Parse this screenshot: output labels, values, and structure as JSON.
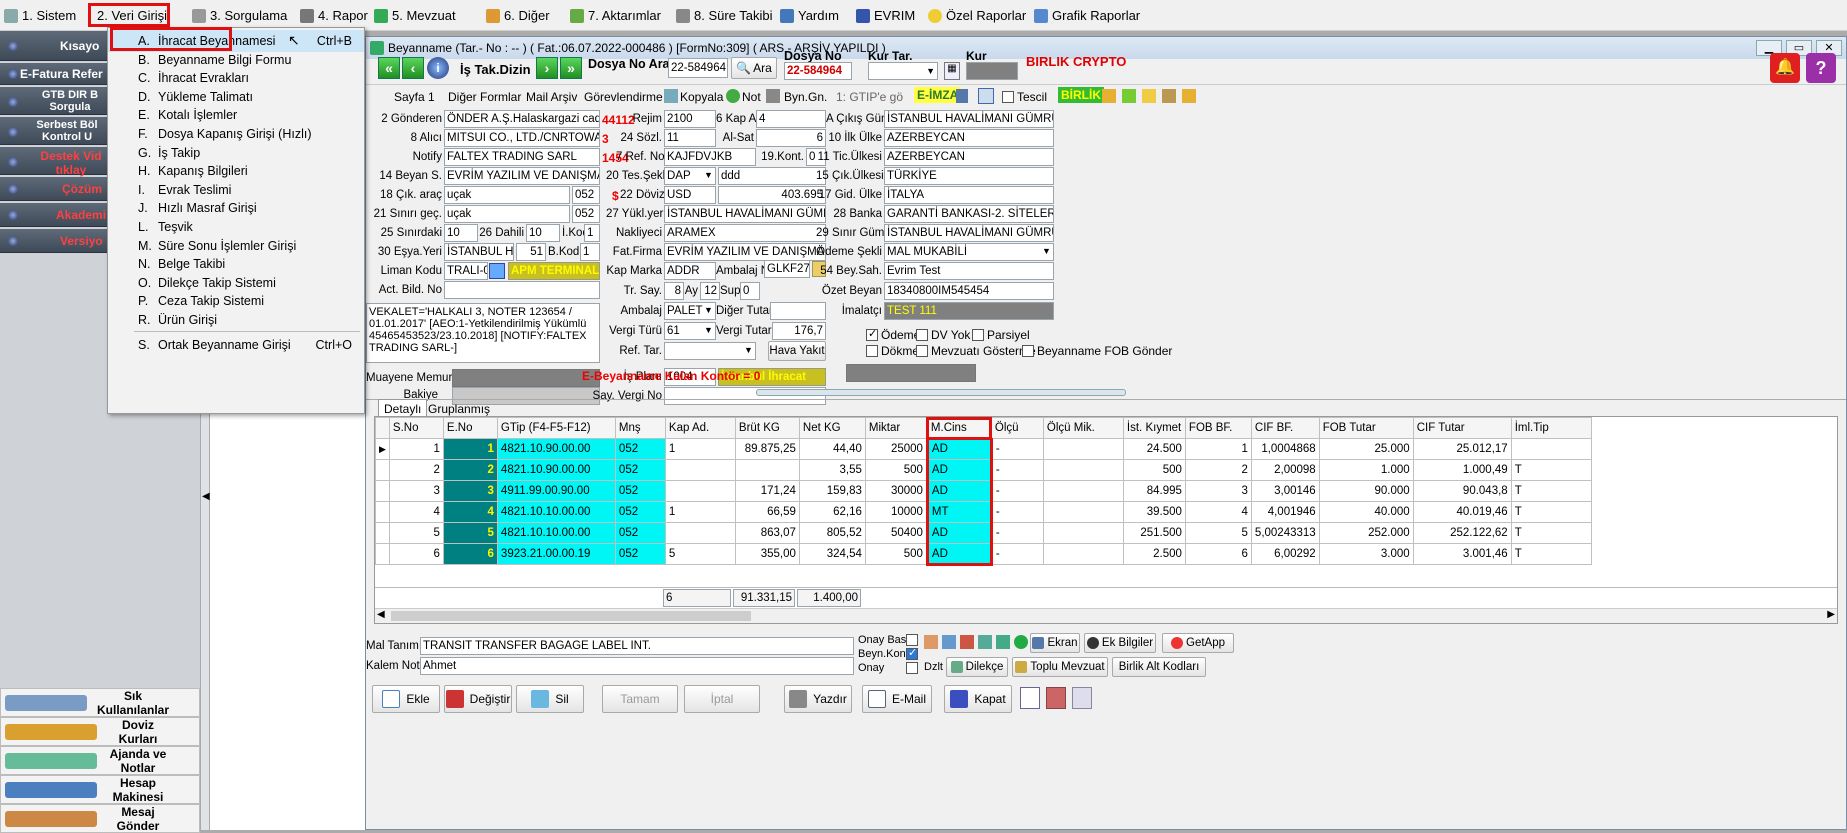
{
  "menubar": [
    "1. Sistem",
    "2. Veri Girişi",
    "3. Sorgulama",
    "4. Rapor",
    "5. Mevzuat",
    "6. Diğer",
    "7. Aktarımlar",
    "8. Süre Takibi",
    "Yardım",
    "EVRIM",
    "Özel Raporlar",
    "Grafik Raporlar"
  ],
  "left": {
    "items": [
      "Kısayo",
      "E-Fatura Refer",
      "GTB DIR B Sorgula",
      "Serbest Böl Kontrol U",
      "Destek Vid tıklay",
      "Çözüm",
      "Akademi",
      "Versiyo"
    ],
    "bottom": [
      "Sık Kullanılanlar",
      "Doviz Kurları",
      "Ajanda ve Notlar",
      "Hesap Makinesi",
      "Mesaj Gönder"
    ]
  },
  "dropdown": [
    {
      "k": "A.",
      "l": "İhracat Beyannamesi",
      "sc": "Ctrl+B"
    },
    {
      "k": "B.",
      "l": "Beyanname Bilgi Formu",
      "sc": ""
    },
    {
      "k": "C.",
      "l": "İhracat Evrakları",
      "sc": ""
    },
    {
      "k": "D.",
      "l": "Yükleme Talimatı",
      "sc": ""
    },
    {
      "k": "E.",
      "l": "Kotalı İşlemler",
      "sc": ""
    },
    {
      "k": "F.",
      "l": "Dosya Kapanış Girişi (Hızlı)",
      "sc": ""
    },
    {
      "k": "G.",
      "l": "İş Takip",
      "sc": ""
    },
    {
      "k": "H.",
      "l": "Kapanış Bilgileri",
      "sc": ""
    },
    {
      "k": "I.",
      "l": "Evrak Teslimi",
      "sc": ""
    },
    {
      "k": "J.",
      "l": "Hızlı Masraf Girişi",
      "sc": ""
    },
    {
      "k": "L.",
      "l": "Teşvik",
      "sc": ""
    },
    {
      "k": "M.",
      "l": "Süre Sonu İşlemler Girişi",
      "sc": ""
    },
    {
      "k": "N.",
      "l": "Belge Takibi",
      "sc": ""
    },
    {
      "k": "O.",
      "l": "Dilekçe Takip Sistemi",
      "sc": ""
    },
    {
      "k": "P.",
      "l": "Ceza Takip Sistemi",
      "sc": ""
    },
    {
      "k": "R.",
      "l": "Ürün Girişi",
      "sc": ""
    },
    {
      "k": "S.",
      "l": "Ortak Beyanname Girişi",
      "sc": "Ctrl+O"
    }
  ],
  "window": {
    "title": "Beyanname (Tar.- No : -- ) ( Fat.:06.07.2022-000486 ) [FormNo:309] ( ARS - ARŞİV YAPILDI )",
    "is_takip": "İş Tak.Dizin",
    "dosya_no_ara": "Dosya No Ara",
    "dosya_input": "22-584964",
    "ara": "Ara",
    "dosya_no_lbl": "Dosya No",
    "dosya_no_val": "22-584964",
    "kur_tar": "Kur Tar.",
    "kur": "Kur",
    "company": "BIRLIK CRYPTO"
  },
  "toolbar2": {
    "sayfa1": "Sayfa 1",
    "diger": "Diğer Formlar",
    "mail": "Mail Arşiv",
    "gorev": "Görevlendirme",
    "kopyala": "Kopyala",
    "not": "Not",
    "byn": "Byn.Gn.",
    "gtip": "1: GTIP'e gö",
    "eimza": "E-İMZA",
    "tescil": "Tescil",
    "birlik": "BİRLİK"
  },
  "form": {
    "gonderen_l": "2 Gönderen",
    "gonderen": "ÖNDER A.Ş.Halaskargazi caddesi Gaz",
    "gonderen_n": "44112",
    "alici_l": "8 Alıcı",
    "alici": "MITSUI CO., LTD./CNRTOWARISTX",
    "alici_n": "3",
    "notify_l": "Notify",
    "notify": "FALTEX TRADING SARL",
    "notify_n": "1454",
    "beyan_l": "14 Beyan S.",
    "beyan": "EVRİM YAZILIM VE DANIŞMANLIK",
    "cik_l": "18 Çık. araç",
    "cik": "uçak",
    "cik2": "052",
    "sinir_l": "21 Sınırı geç.",
    "sinir": "uçak",
    "sinir2": "052",
    "sinirdaki_l": "25 Sınırdaki",
    "sinirdaki": "10",
    "dahili_l": "26 Dahili",
    "dahili": "10",
    "ikod_l": "İ.Kod",
    "ikod": "1",
    "esya_l": "30 Eşya.Yeri",
    "esya": "İSTANBUL HAV.",
    "esya2": "51",
    "bkod_l": "B.Kod",
    "bkod": "1",
    "liman_l": "Liman Kodu",
    "liman": "TRALI-00",
    "liman2": "APM TERMINALS",
    "actbild_l": "Act. Bild. No",
    "actbild": "",
    "memo": "VEKALET='HALKALI 3, NOTER 123654 / 01.01.2017' [AEO:1-Yetkilendirilmiş Yükümlü 45465453523/23.10.2018] [NOTIFY:FALTEX TRADING SARL-]",
    "muayene_l": "Muayene Memuru",
    "bakiye_l": "Bakiye",
    "rejim_l": "Rejim",
    "rejim": "2100",
    "kapa_l": "6 Kap A.",
    "kapa": "4",
    "sozl_l": "24 Sözl.",
    "sozl": "11",
    "ala_l": "Al-Sat",
    "ala": "6",
    "ref_l": "7 Ref. No",
    "ref": "KAJFDVJKB",
    "kont_l": "19.Kont.",
    "kont": "0",
    "tes_l": "20 Tes.Şekli",
    "tes": "DAP",
    "tes2": "ddd",
    "doviz_sym": "$",
    "doviz_l": "22 Döviz",
    "doviz": "USD",
    "doviz_v": "403.695",
    "yuk_l": "27 Yükl.yeri",
    "yuk": "İSTANBUL HAVALİMANI GÜMRÜK MÜ",
    "nak_l": "Nakliyeci",
    "nak": "ARAMEX",
    "fat_l": "Fat.Firma",
    "fat": "EVRİM YAZILIM VE DANIŞMANLIK LT",
    "kapm_l": "Kap Marka",
    "kapm": "ADDR",
    "amb_l": "Ambalaj No",
    "amb": "GLKF2717",
    "trs_l": "Tr. Say.",
    "trs": "8",
    "ay_l": "Ay",
    "ay": "12",
    "sup_l": "Sup",
    "sup": "0",
    "ambalaj_l": "Ambalaj",
    "ambalaj": "PALET",
    "diger_l": "Diğer Tutar",
    "diger": "",
    "vergi_l": "Vergi Türü",
    "vergi": "61",
    "vtutar_l": "Vergi Tutar",
    "vtutar": "176,7",
    "reft_l": "Ref. Tar.",
    "hava": "Hava Yakıt",
    "isp_l": "İş Planı",
    "isp": "1004",
    "isp2": "İstanbul İhracat",
    "sayv_l": "Say. Vergi No",
    "ekontor": "E-Beyanname Kalan Kontör = 0",
    "acik_l": "A Çıkış Güm.",
    "acik": "İSTANBUL HAVALİMANI GÜMRÜK",
    "ilk_l": "10 İlk Ülke",
    "ilk": "AZERBEYCAN",
    "tic_l": "11 Tic.Ülkesi",
    "tic": "AZERBEYCAN",
    "cikul_l": "15 Çık.Ülkesi",
    "cikul": "TÜRKİYE",
    "gid_l": "17 Gid. Ülke",
    "gid": "İTALYA",
    "banka_l": "28 Banka",
    "banka": "GARANTİ BANKASI-2. SİTELER ŞB",
    "sinrg_l": "29 Sınır Güm.",
    "sinrg": "İSTANBUL HAVALİMANI GÜMRÜK",
    "odeme_l": "Ödeme Şekli",
    "odeme": "MAL MUKABİLİ",
    "bey_l": "54 Bey.Sah.",
    "bey": "Evrim Test",
    "ozet_l": "Özet Beyan",
    "ozet": "18340800IM545454",
    "imal_l": "İmalatçı",
    "imal": "TEST 111",
    "c_odeme": "Ödeme",
    "c_dv": "DV Yok",
    "c_pars": "Parsiyel",
    "c_dokme": "Dökme",
    "c_mevz": "Mevzuatı Gösterme",
    "c_fob": "Beyanname FOB Gönder"
  },
  "tabs": [
    "Detaylı",
    "Gruplanmış"
  ],
  "grid": {
    "headers": [
      "S.No",
      "E.No",
      "GTip (F4-F5-F12)",
      "Mnş",
      "Kap Ad.",
      "Brüt KG",
      "Net KG",
      "Miktar",
      "M.Cins",
      "Ölçü",
      "Ölçü Mik.",
      "İst. Kıymet",
      "FOB BF.",
      "CIF BF.",
      "FOB Tutar",
      "CIF Tutar",
      "İml.Tip"
    ],
    "rows": [
      [
        "1",
        "1",
        "4821.10.90.00.00",
        "052",
        "1",
        "89.875,25",
        "44,40",
        "25000",
        "AD",
        "-",
        "",
        "24.500",
        "1",
        "1,0004868",
        "25.000",
        "25.012,17",
        ""
      ],
      [
        "2",
        "2",
        "4821.10.90.00.00",
        "052",
        "",
        "",
        "3,55",
        "500",
        "AD",
        "-",
        "",
        "500",
        "2",
        "2,00098",
        "1.000",
        "1.000,49",
        "T"
      ],
      [
        "3",
        "3",
        "4911.99.00.90.00",
        "052",
        "",
        "171,24",
        "159,83",
        "30000",
        "AD",
        "-",
        "",
        "84.995",
        "3",
        "3,00146",
        "90.000",
        "90.043,8",
        "T"
      ],
      [
        "4",
        "4",
        "4821.10.10.00.00",
        "052",
        "1",
        "66,59",
        "62,16",
        "10000",
        "MT",
        "-",
        "",
        "39.500",
        "4",
        "4,001946",
        "40.000",
        "40.019,46",
        "T"
      ],
      [
        "5",
        "5",
        "4821.10.10.00.00",
        "052",
        "",
        "863,07",
        "805,52",
        "50400",
        "AD",
        "-",
        "",
        "251.500",
        "5",
        "5,00243313",
        "252.000",
        "252.122,62",
        "T"
      ],
      [
        "6",
        "6",
        "3923.21.00.00.19",
        "052",
        "5",
        "355,00",
        "324,54",
        "500",
        "AD",
        "-",
        "",
        "2.500",
        "6",
        "6,00292",
        "3.000",
        "3.001,46",
        "T"
      ]
    ],
    "tot_kap": "6",
    "tot_brut": "91.331,15",
    "tot_net": "1.400,00"
  },
  "bottom": {
    "mal_l": "Mal Tanımı",
    "mal": "TRANSIT TRANSFER BAGAGE LABEL INT.",
    "kalem_l": "Kalem Not",
    "kalem": "Ahmet",
    "onay_bas": "Onay Bas.",
    "beyn_kont": "Beyn.Kont.",
    "onay": "Onay",
    "dzlt": "Dzlt",
    "dilekce": "Dilekçe",
    "toplu": "Toplu Mevzuat",
    "birlik_alt": "Birlik Alt Kodları",
    "ekran": "Ekran",
    "ek": "Ek Bilgiler",
    "getapp": "GetApp"
  },
  "buttons": [
    "Ekle",
    "Değiştir",
    "Sil",
    "Tamam",
    "İptal",
    "Yazdır",
    "E-Mail",
    "Kapat"
  ]
}
